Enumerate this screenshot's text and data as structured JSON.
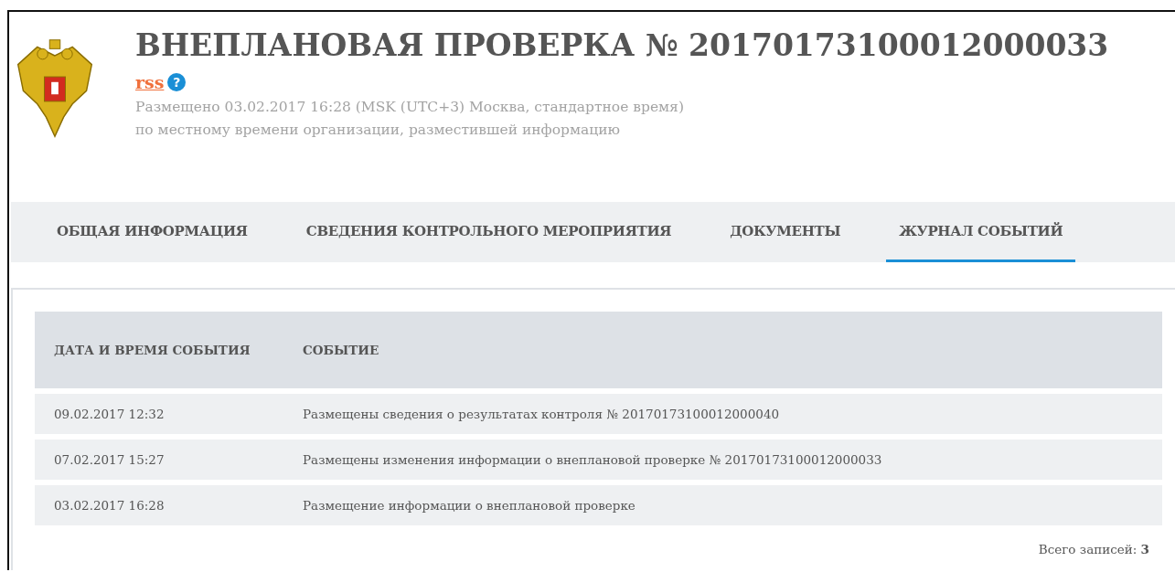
{
  "header": {
    "title": "ВНЕПЛАНОВАЯ ПРОВЕРКА № 20170173100012000033",
    "rss": "rss",
    "help": "?",
    "posted": "Размещено 03.02.2017 16:28 (MSK (UTC+3) Москва, стандартное время)",
    "timezone_note": "по местному времени организации, разместившей информацию"
  },
  "tabs": [
    {
      "label": "ОБЩАЯ ИНФОРМАЦИЯ",
      "selected": false
    },
    {
      "label": "СВЕДЕНИЯ КОНТРОЛЬНОГО МЕРОПРИЯТИЯ",
      "selected": false
    },
    {
      "label": "ДОКУМЕНТЫ",
      "selected": false
    },
    {
      "label": "ЖУРНАЛ СОБЫТИЙ",
      "selected": true
    }
  ],
  "table": {
    "columns": [
      "ДАТА И ВРЕМЯ СОБЫТИЯ",
      "СОБЫТИЕ"
    ],
    "rows": [
      [
        "09.02.2017 12:32",
        "Размещены сведения о результатах контроля № 20170173100012000040"
      ],
      [
        "07.02.2017 15:27",
        "Размещены изменения информации о внеплановой проверке № 20170173100012000033"
      ],
      [
        "03.02.2017 16:28",
        "Размещение информации о внеплановой проверке"
      ]
    ]
  },
  "total": "Всего записей: **3**"
}
